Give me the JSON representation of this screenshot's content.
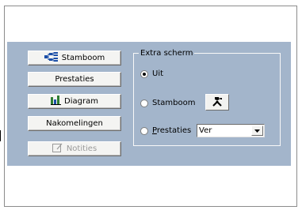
{
  "buttons": {
    "stamboom": "Stamboom",
    "prestaties": "Prestaties",
    "diagram": "Diagram",
    "nakomelingen": "Nakomelingen",
    "notities": "Notities"
  },
  "extra_scherm": {
    "title": "Extra scherm",
    "options": [
      {
        "label": "Uit",
        "checked": true
      },
      {
        "label": "Stamboom",
        "checked": false
      },
      {
        "label_first": "P",
        "label_rest": "restaties",
        "checked": false
      }
    ],
    "select_value": "Ver"
  },
  "icons": {
    "stamboom": "tree-icon",
    "diagram": "bar-chart-icon",
    "notities": "note-icon",
    "tool": "tools-icon",
    "dropdown": "chevron-down-icon"
  },
  "colors": {
    "panel": "#a3b5cb",
    "tree_icon": "#1c4fa8",
    "diagram_icon": "#2e7d32"
  }
}
